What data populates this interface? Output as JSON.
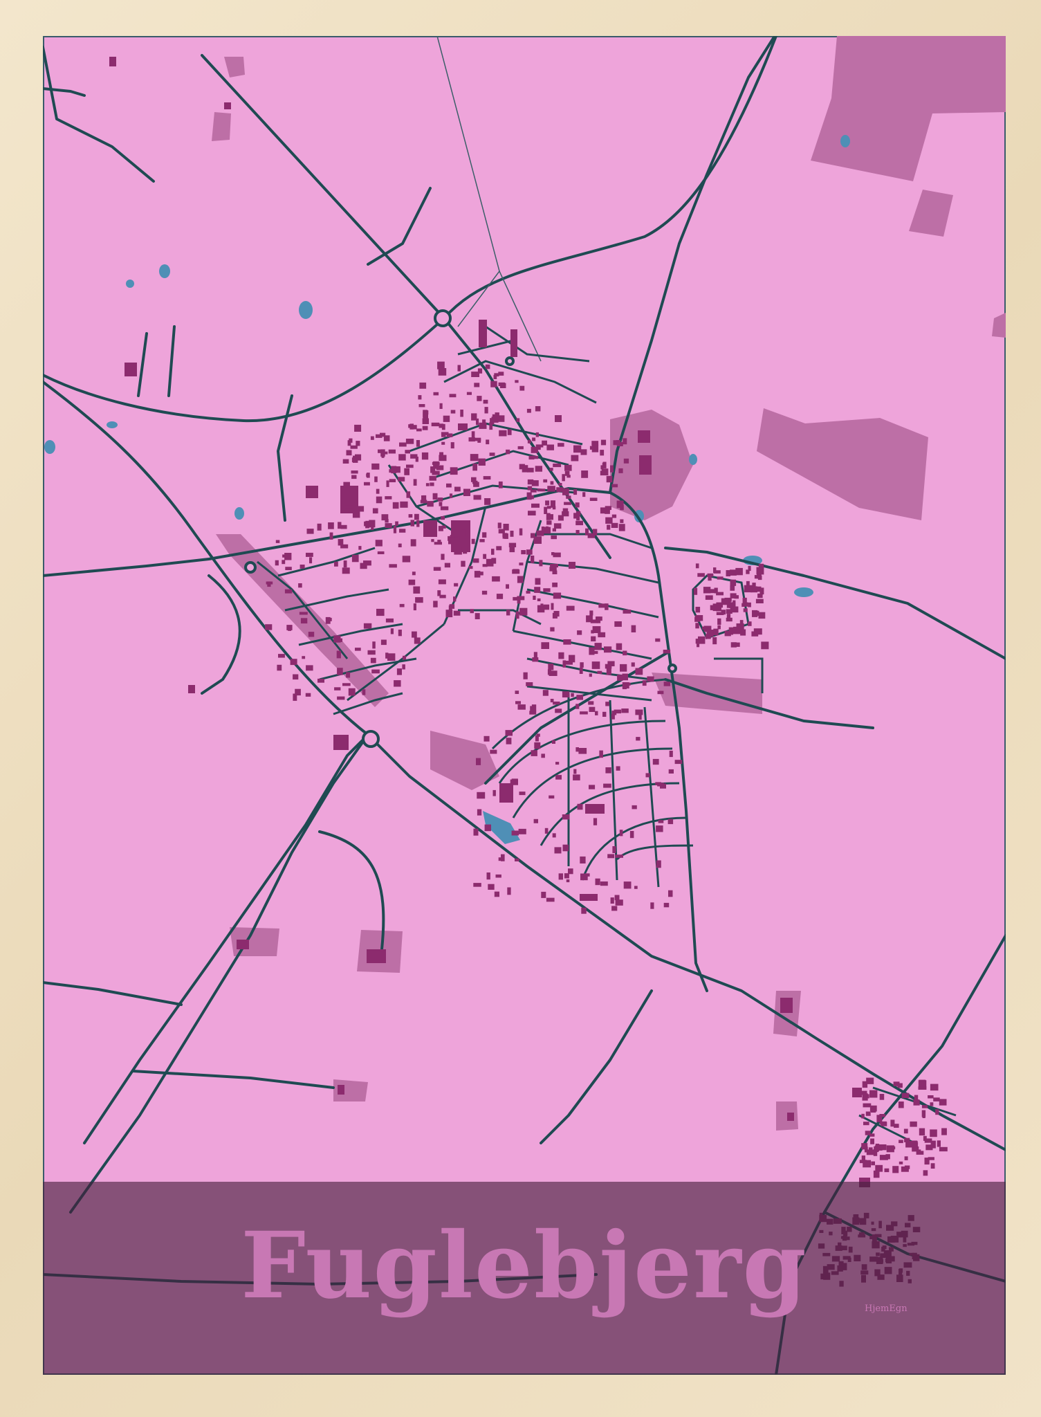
{
  "poster": {
    "title": "Fuglebjerg",
    "brand": "HjemEgn"
  },
  "colors": {
    "background": "#eea4da",
    "area": "#bd6fa6",
    "building": "#8c2b6e",
    "road": "#1f4a52",
    "water": "#4f8fb6",
    "band": "#5a2448",
    "frame": "#efe0c4"
  },
  "icons": [
    "roundabout-icon",
    "roundabout-icon",
    "roundabout-icon"
  ]
}
